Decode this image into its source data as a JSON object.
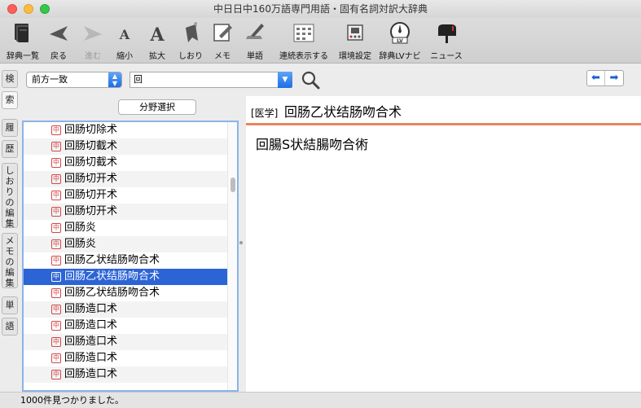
{
  "window": {
    "title": "中日日中160万語専門用語・固有名詞対訳大辞典"
  },
  "toolbar": {
    "items": [
      {
        "label": "辞典一覧",
        "icon": "book-stack-icon",
        "enabled": true
      },
      {
        "label": "戻る",
        "icon": "back-arrow-icon",
        "enabled": true
      },
      {
        "label": "進む",
        "icon": "forward-arrow-icon",
        "enabled": false
      },
      {
        "label": "縮小",
        "icon": "font-smaller-icon",
        "enabled": true
      },
      {
        "label": "拡大",
        "icon": "font-larger-icon",
        "enabled": true
      },
      {
        "label": "しおり",
        "icon": "bookmark-icon",
        "enabled": true
      },
      {
        "label": "メモ",
        "icon": "memo-icon",
        "enabled": true
      },
      {
        "label": "単語",
        "icon": "word-icon",
        "enabled": true
      },
      {
        "label": "連続表示する",
        "icon": "continuous-display-icon",
        "enabled": true
      },
      {
        "label": "環境設定",
        "icon": "preferences-icon",
        "enabled": true
      },
      {
        "label": "辞典LVナビ",
        "icon": "lv-navi-compass-icon",
        "enabled": true
      },
      {
        "label": "ニュース",
        "icon": "mailbox-icon",
        "enabled": true
      }
    ]
  },
  "search": {
    "mode": "前方一致",
    "query": "回",
    "back_arrow": "⬅",
    "forward_arrow": "➡"
  },
  "side_tabs": [
    {
      "label": "検",
      "active": false
    },
    {
      "label": "索",
      "active": true
    },
    {
      "label": "履",
      "active": false
    },
    {
      "label": "歴",
      "active": false
    },
    {
      "label": "しおりの編集",
      "active": false
    },
    {
      "label": "メモの編集",
      "active": false
    },
    {
      "label": "単",
      "active": false
    },
    {
      "label": "語",
      "active": false
    }
  ],
  "field_select_button": "分野選択",
  "results": {
    "badge": "中",
    "items": [
      "回肠切除术",
      "回肠切截术",
      "回肠切截术",
      "回肠切开术",
      "回肠切开术",
      "回肠切开术",
      "回肠炎",
      "回肠炎",
      "回肠乙状结肠吻合术",
      "回肠乙状结肠吻合术",
      "回肠乙状结肠吻合术",
      "回肠造口术",
      "回肠造口术",
      "回肠造口术",
      "回肠造口术",
      "回肠造口术"
    ],
    "selected_index": 9
  },
  "detail": {
    "field_tag": "[医学]",
    "headword": "回肠乙状结肠吻合术",
    "translation": "回腸S状結腸吻合術",
    "accent_color": "#e5865f"
  },
  "status": {
    "text": "1000件見つかりました。"
  }
}
